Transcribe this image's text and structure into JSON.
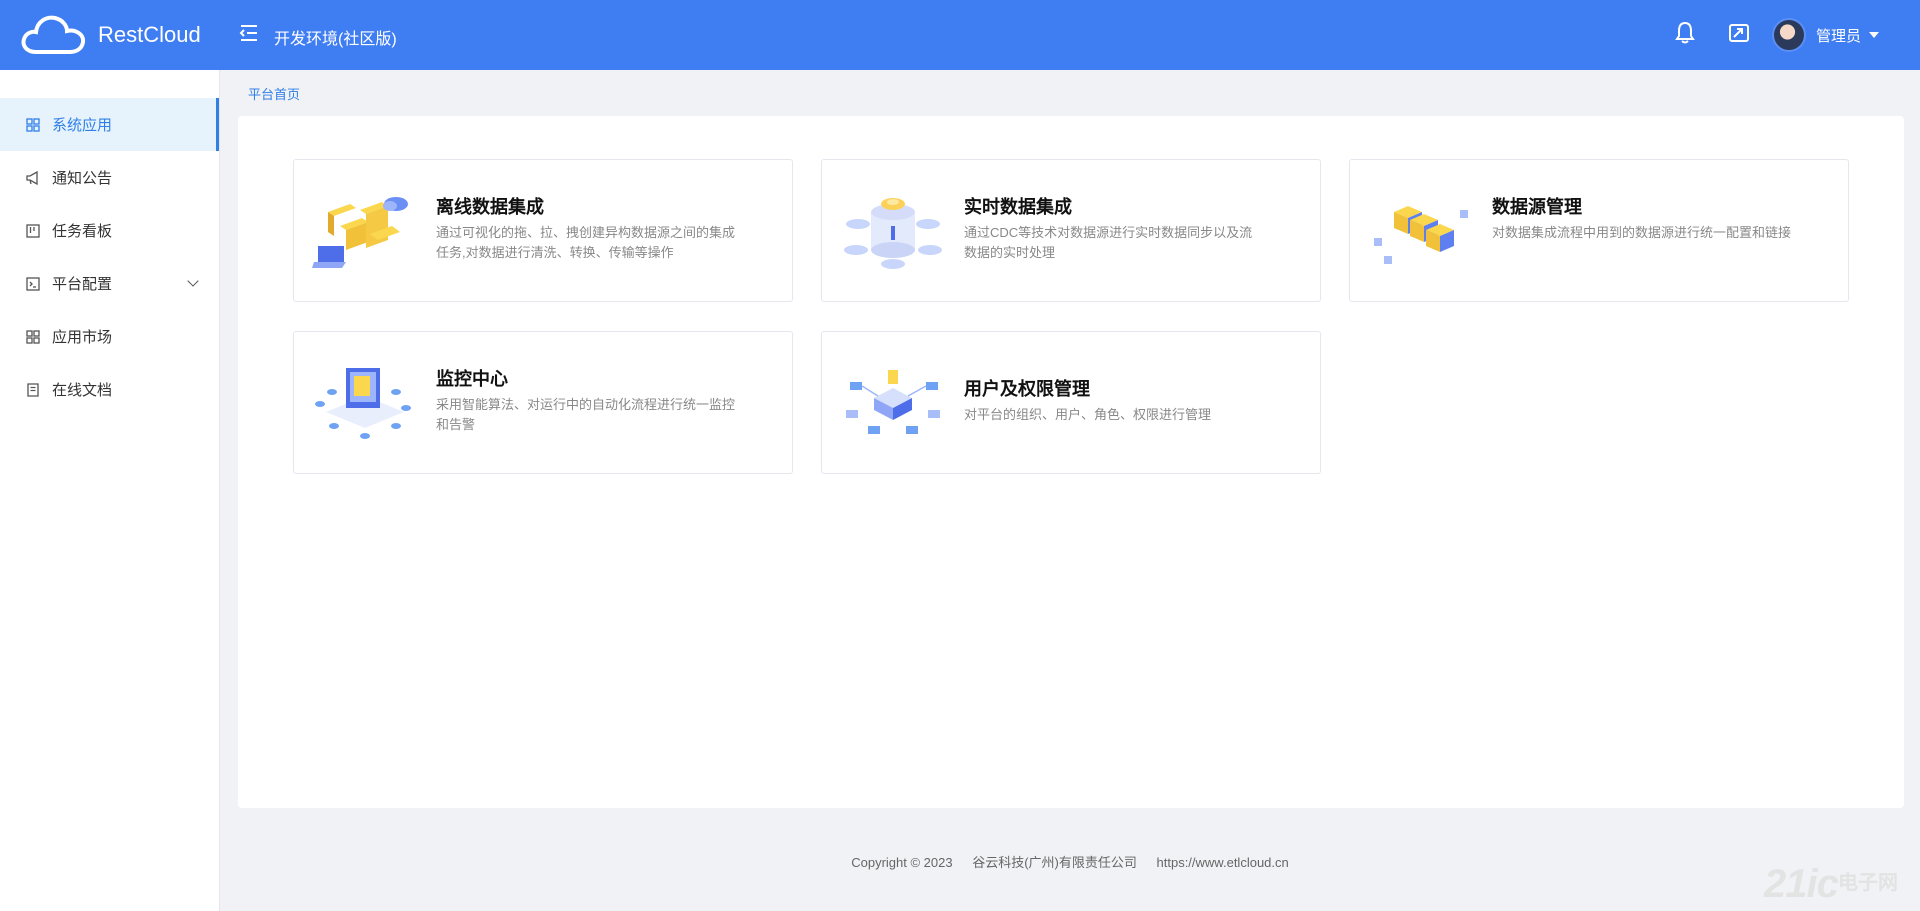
{
  "header": {
    "brand": "RestCloud",
    "env_title": "开发环境(社区版)",
    "user_name": "管理员",
    "icons": [
      "menu-toggle-icon",
      "bell-icon",
      "share-icon"
    ]
  },
  "sidebar": {
    "items": [
      {
        "label": "系统应用",
        "icon": "grid-icon",
        "active": true
      },
      {
        "label": "通知公告",
        "icon": "megaphone-icon"
      },
      {
        "label": "任务看板",
        "icon": "board-icon"
      },
      {
        "label": "平台配置",
        "icon": "terminal-icon",
        "expandable": true
      },
      {
        "label": "应用市场",
        "icon": "grid-icon"
      },
      {
        "label": "在线文档",
        "icon": "document-icon"
      }
    ]
  },
  "breadcrumb": "平台首页",
  "cards": [
    {
      "title": "离线数据集成",
      "desc": "通过可视化的拖、拉、拽创建异构数据源之间的集成任务,对数据进行清洗、转换、传输等操作",
      "icon": "etl-illustration"
    },
    {
      "title": "实时数据集成",
      "desc": "通过CDC等技术对数据源进行实时数据同步以及流数据的实时处理",
      "icon": "realtime-illustration"
    },
    {
      "title": "数据源管理",
      "desc": "对数据集成流程中用到的数据源进行统一配置和链接",
      "icon": "datasource-illustration"
    },
    {
      "title": "监控中心",
      "desc": "采用智能算法、对运行中的自动化流程进行统一监控和告警",
      "icon": "monitor-illustration"
    },
    {
      "title": "用户及权限管理",
      "desc": "对平台的组织、用户、角色、权限进行管理",
      "icon": "permission-illustration"
    }
  ],
  "footer": {
    "copyright": "Copyright © 2023",
    "company": "谷云科技(广州)有限责任公司",
    "url": "https://www.etlcloud.cn"
  },
  "watermark": {
    "text": "21ic",
    "cn": "电子网"
  },
  "colors": {
    "primary": "#3f7df2",
    "active": "#2f7fe6",
    "active_bg": "#e6f3fd"
  }
}
